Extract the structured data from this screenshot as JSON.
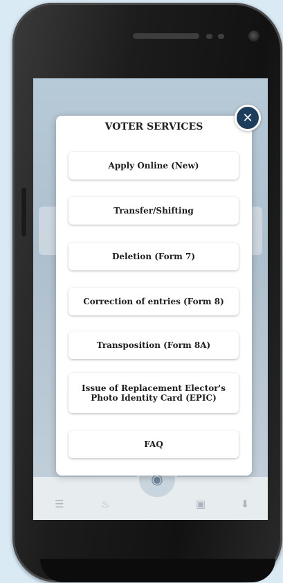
{
  "modal": {
    "title": "VOTER SERVICES",
    "close_icon": "close-icon",
    "services": [
      {
        "label": "Apply Online (New)"
      },
      {
        "label": "Transfer/Shifting"
      },
      {
        "label": "Deletion (Form 7)"
      },
      {
        "label": "Correction of entries (Form 8)"
      },
      {
        "label": "Transposition (Form 8A)"
      },
      {
        "label": "Issue of Replacement Elector's Photo Identity Card (EPIC)"
      },
      {
        "label": "FAQ"
      }
    ]
  },
  "bottom_nav": {
    "icons": [
      "menu-icon",
      "fire-icon",
      "center-app-icon",
      "image-icon",
      "download-icon"
    ]
  },
  "colors": {
    "accent": "#1d3d5c",
    "modal_bg": "#ffffff",
    "page_bg": "#d9eaf5"
  }
}
